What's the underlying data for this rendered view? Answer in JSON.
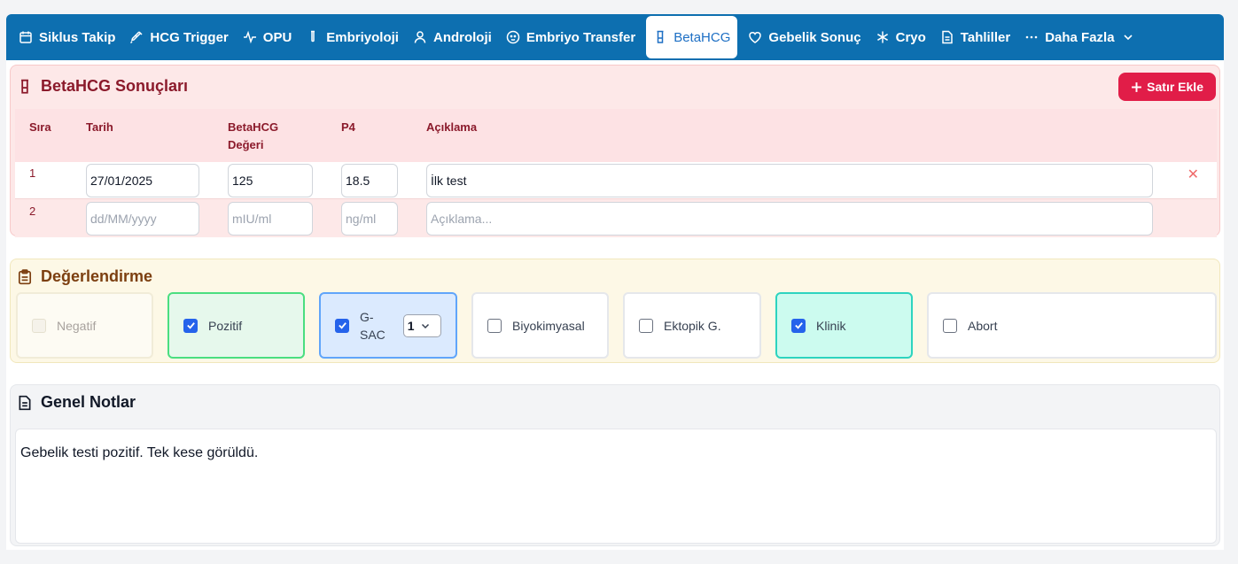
{
  "nav": {
    "tabs": [
      {
        "label": "Siklus Takip",
        "icon": "calendar-icon"
      },
      {
        "label": "HCG Trigger",
        "icon": "syringe-icon"
      },
      {
        "label": "OPU",
        "icon": "activity-icon"
      },
      {
        "label": "Embriyoloji",
        "icon": "test-tube-icon"
      },
      {
        "label": "Androloji",
        "icon": "user-icon"
      },
      {
        "label": "Embriyo Transfer",
        "icon": "baby-icon"
      },
      {
        "label": "BetaHCG",
        "icon": "beaker-icon",
        "active": true
      },
      {
        "label": "Gebelik Sonuç",
        "icon": "heart-icon"
      },
      {
        "label": "Cryo",
        "icon": "snowflake-icon"
      },
      {
        "label": "Tahliller",
        "icon": "file-text-icon"
      },
      {
        "label": "Daha Fazla",
        "icon": "more-icon"
      }
    ]
  },
  "results": {
    "title": "BetaHCG Sonuçları",
    "add_button": "Satır Ekle",
    "columns": {
      "sira": "Sıra",
      "tarih": "Tarih",
      "beta_line1": "BetaHCG",
      "beta_line2": "Değeri",
      "p4": "P4",
      "aciklama": "Açıklama"
    },
    "rows": [
      {
        "num": "1",
        "date": "27/01/2025",
        "beta": "125",
        "p4": "18.5",
        "note": "İlk test"
      },
      {
        "num": "2",
        "date": "",
        "beta": "",
        "p4": "",
        "note": ""
      }
    ],
    "placeholders": {
      "date": "dd/MM/yyyy",
      "beta": "mIU/ml",
      "p4": "ng/ml",
      "note": "Açıklama..."
    },
    "delete_symbol": "✕"
  },
  "evaluation": {
    "title": "Değerlendirme",
    "options": [
      {
        "label": "Negatif",
        "checked": false,
        "disabled": true
      },
      {
        "label": "Pozitif",
        "checked": true
      },
      {
        "label_line1": "G-",
        "label_line2": "SAC",
        "checked": true,
        "select_value": "1"
      },
      {
        "label": "Biyokimyasal",
        "checked": false
      },
      {
        "label": "Ektopik G.",
        "checked": false
      },
      {
        "label": "Klinik",
        "checked": true
      },
      {
        "label": "Abort",
        "checked": false
      }
    ]
  },
  "notes": {
    "title": "Genel Notlar",
    "text": "Gebelik testi pozitif. Tek kese görüldü."
  }
}
